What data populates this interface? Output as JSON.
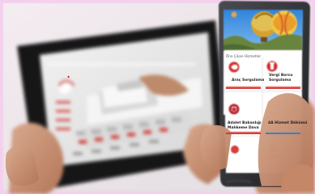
{
  "phone_ui": {
    "section_title": "Öne Çıkan Hizmetler",
    "tiles": [
      {
        "label_line1": "Araç Sorgulama",
        "label_line2": "",
        "icon": "car-icon"
      },
      {
        "label_line1": "Vergi Borcu",
        "label_line2": "Sorgulama",
        "icon": "tax-icon"
      },
      {
        "label_line1": "Adalet Bakanlığı",
        "label_line2": "Mahkeme Dava",
        "icon": "justice-icon"
      },
      {
        "label_line1": "4A Hizmet Dökümü",
        "label_line2": "",
        "icon": "service-record-icon"
      }
    ]
  },
  "colors": {
    "brand_red": "#d0232a",
    "phone_body": "#2d2d31",
    "tablet_frame": "#1c1c1e",
    "sky_blue": "#4b9be9",
    "border_pink": "#f4d0ee"
  }
}
